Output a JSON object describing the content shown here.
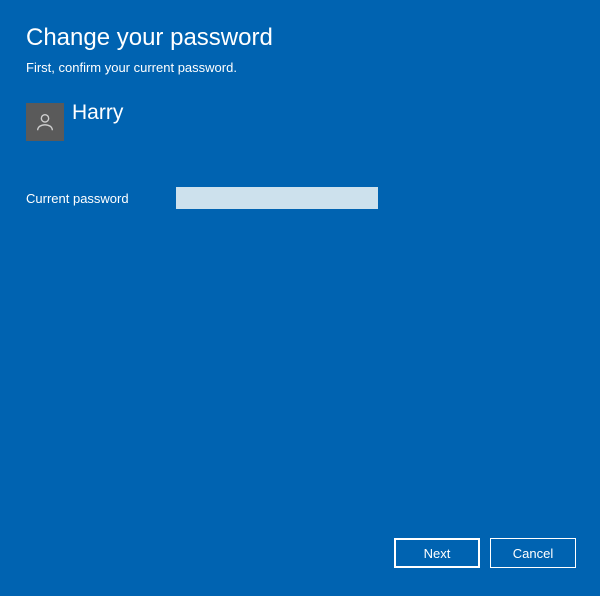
{
  "header": {
    "title": "Change your password",
    "subtitle": "First, confirm your current password."
  },
  "user": {
    "name": "Harry",
    "avatar_icon": "user-icon"
  },
  "form": {
    "current_password_label": "Current password",
    "current_password_value": ""
  },
  "footer": {
    "next_label": "Next",
    "cancel_label": "Cancel"
  },
  "colors": {
    "background": "#0063b1",
    "avatar_bg": "#5a5a5a",
    "input_bg": "#cde1ed",
    "text": "#ffffff"
  }
}
